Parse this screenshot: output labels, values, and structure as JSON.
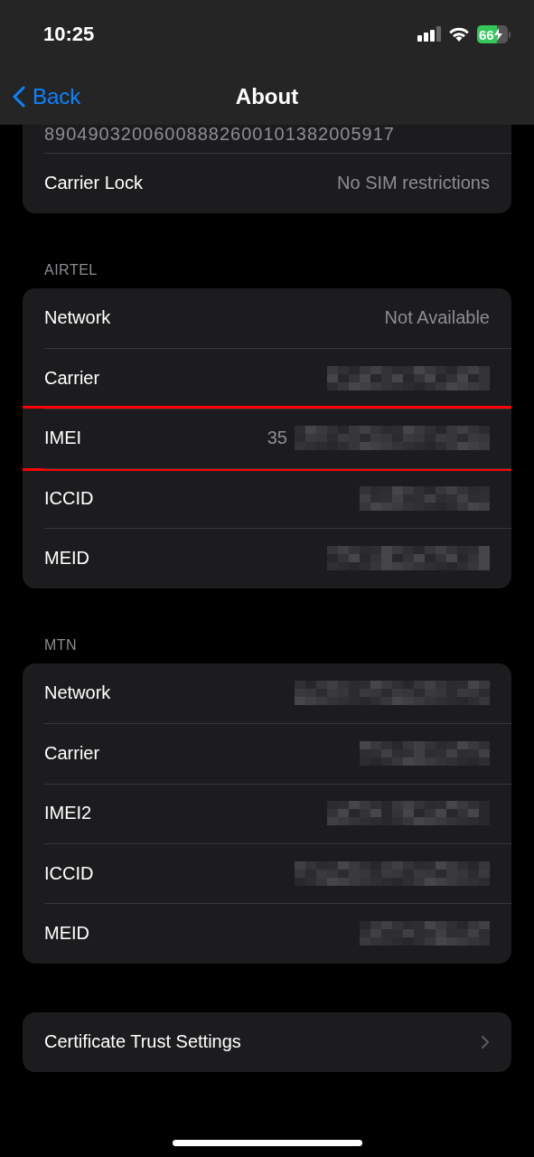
{
  "status_bar": {
    "time": "10:25",
    "battery": "66",
    "charging": true
  },
  "nav": {
    "back": "Back",
    "title": "About"
  },
  "sections": [
    {
      "rows": [
        {
          "label": null,
          "value": "89049032006008882600101382005917",
          "redacted": false,
          "highlighted": false
        },
        {
          "label": "Carrier Lock",
          "value": "No SIM restrictions",
          "redacted": false,
          "highlighted": false
        }
      ]
    },
    {
      "header": "AIRTEL",
      "rows": [
        {
          "label": "Network",
          "value": "Not Available",
          "redacted": false,
          "highlighted": false
        },
        {
          "label": "Carrier",
          "redacted": true,
          "highlighted": false
        },
        {
          "label": "IMEI",
          "value": "35",
          "redacted": true,
          "highlighted": true
        },
        {
          "label": "ICCID",
          "redacted": true,
          "highlighted": false
        },
        {
          "label": "MEID",
          "redacted": true,
          "highlighted": false
        }
      ]
    },
    {
      "header": "MTN",
      "rows": [
        {
          "label": "Network",
          "redacted": true,
          "highlighted": false
        },
        {
          "label": "Carrier",
          "redacted": true,
          "highlighted": false
        },
        {
          "label": "IMEI2",
          "redacted": true,
          "highlighted": false
        },
        {
          "label": "ICCID",
          "redacted": true,
          "highlighted": false
        },
        {
          "label": "MEID",
          "redacted": true,
          "highlighted": false
        }
      ]
    },
    {
      "rows": [
        {
          "label": "Certificate Trust Settings",
          "kind": "link",
          "redacted": false,
          "highlighted": false
        }
      ]
    }
  ]
}
